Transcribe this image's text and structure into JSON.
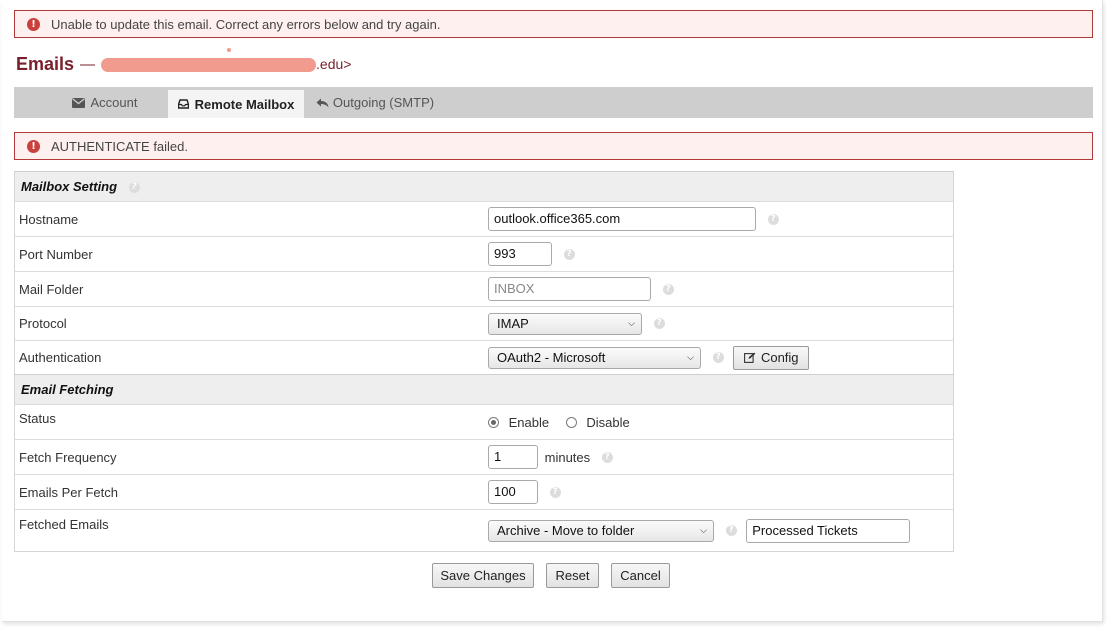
{
  "error_top": {
    "message": "Unable to update this email. Correct any errors below and try again."
  },
  "header": {
    "title": "Emails",
    "separator": "—",
    "email_suffix": ".edu>"
  },
  "tabs": [
    {
      "label": "Account",
      "icon": "envelope-icon",
      "active": false
    },
    {
      "label": "Remote Mailbox",
      "icon": "inbox-icon",
      "active": true
    },
    {
      "label": "Outgoing (SMTP)",
      "icon": "reply-icon",
      "active": false
    }
  ],
  "error_auth": {
    "message": "AUTHENTICATE failed."
  },
  "mailbox": {
    "section_title": "Mailbox Setting",
    "hostname": {
      "label": "Hostname",
      "value": "outlook.office365.com"
    },
    "port": {
      "label": "Port Number",
      "value": "993"
    },
    "folder": {
      "label": "Mail Folder",
      "placeholder": "INBOX"
    },
    "protocol": {
      "label": "Protocol",
      "selected": "IMAP"
    },
    "auth": {
      "label": "Authentication",
      "selected": "OAuth2 - Microsoft",
      "config_label": "Config"
    }
  },
  "fetching": {
    "section_title": "Email Fetching",
    "status": {
      "label": "Status",
      "enable": "Enable",
      "disable": "Disable",
      "selected": "Enable"
    },
    "frequency": {
      "label": "Fetch Frequency",
      "value": "1",
      "unit": "minutes"
    },
    "per_fetch": {
      "label": "Emails Per Fetch",
      "value": "100"
    },
    "fetched": {
      "label": "Fetched Emails",
      "selected": "Archive - Move to folder",
      "folder": "Processed Tickets"
    }
  },
  "actions": {
    "save": "Save Changes",
    "reset": "Reset",
    "cancel": "Cancel"
  },
  "colors": {
    "title": "#7a1f2b",
    "error_border": "#b33a3a",
    "error_bg": "#fff0f0",
    "error_icon": "#c9413d"
  }
}
